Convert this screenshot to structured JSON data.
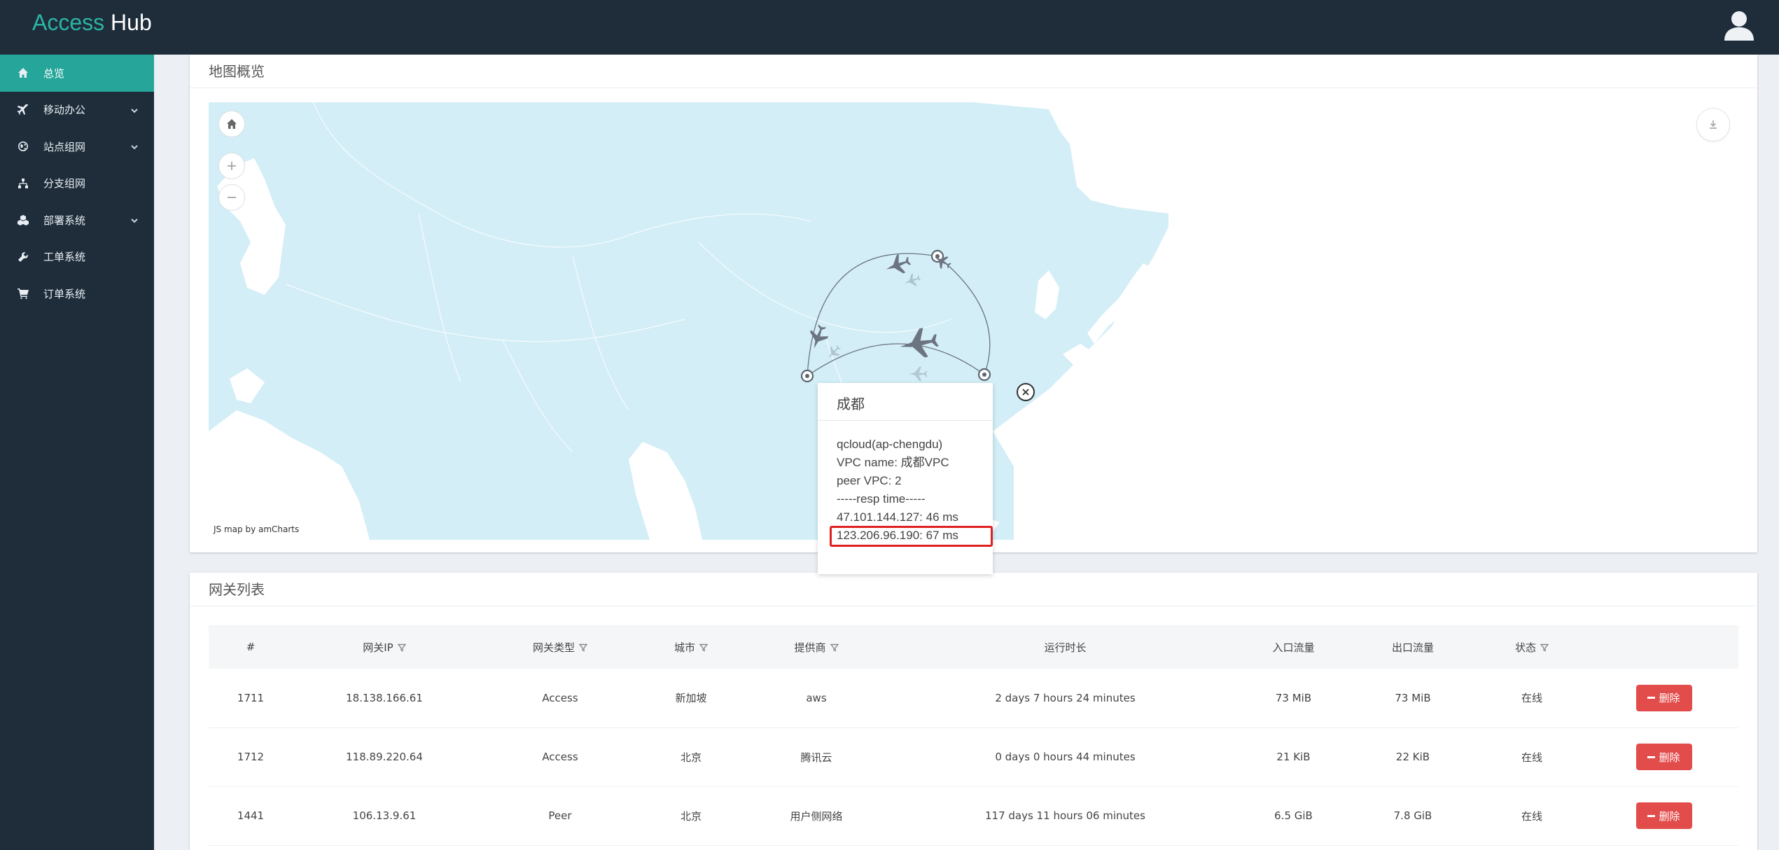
{
  "header": {
    "logo_part1": "Access",
    "logo_part2": "Hub",
    "user_icon": "user-icon"
  },
  "sidebar": {
    "items": [
      {
        "label": "总览",
        "icon": "home-icon",
        "active": true
      },
      {
        "label": "移动办公",
        "icon": "plane-icon",
        "has_caret": true
      },
      {
        "label": "站点组网",
        "icon": "globe-icon",
        "has_caret": true
      },
      {
        "label": "分支组网",
        "icon": "sitemap-icon"
      },
      {
        "label": "部署系统",
        "icon": "cubes-icon",
        "has_caret": true
      },
      {
        "label": "工单系统",
        "icon": "wrench-icon"
      },
      {
        "label": "订单系统",
        "icon": "cart-icon"
      }
    ]
  },
  "map_panel": {
    "title": "地图概览",
    "credit": "JS map by amCharts",
    "popup": {
      "title": "成都",
      "lines": [
        "qcloud(ap-chengdu)",
        "VPC name: 成都VPC",
        "peer VPC: 2",
        "-----resp time-----",
        "47.101.144.127: 46 ms",
        "123.206.96.190: 67 ms"
      ]
    }
  },
  "gateway_panel": {
    "title": "网关列表",
    "columns": [
      "#",
      "网关IP",
      "网关类型",
      "城市",
      "提供商",
      "运行时长",
      "入口流量",
      "出口流量",
      "状态"
    ],
    "delete_label": "删除",
    "rows": [
      {
        "id": "1711",
        "ip": "18.138.166.61",
        "type": "Access",
        "city": "新加坡",
        "provider": "aws",
        "uptime": "2 days 7 hours 24 minutes",
        "in": "73 MiB",
        "out": "73 MiB",
        "status": "在线"
      },
      {
        "id": "1712",
        "ip": "118.89.220.64",
        "type": "Access",
        "city": "北京",
        "provider": "腾讯云",
        "uptime": "0 days 0 hours 44 minutes",
        "in": "21 KiB",
        "out": "22 KiB",
        "status": "在线"
      },
      {
        "id": "1441",
        "ip": "106.13.9.61",
        "type": "Peer",
        "city": "北京",
        "provider": "用户侧网络",
        "uptime": "117 days 11 hours 06 minutes",
        "in": "6.5 GiB",
        "out": "7.8 GiB",
        "status": "在线"
      }
    ]
  },
  "colors": {
    "header_bg": "#1f2d3a",
    "accent": "#26a69a",
    "sea": "#d3eef7",
    "land": "#ffffff",
    "delete": "#e24c4b",
    "highlight": "#e02020"
  }
}
